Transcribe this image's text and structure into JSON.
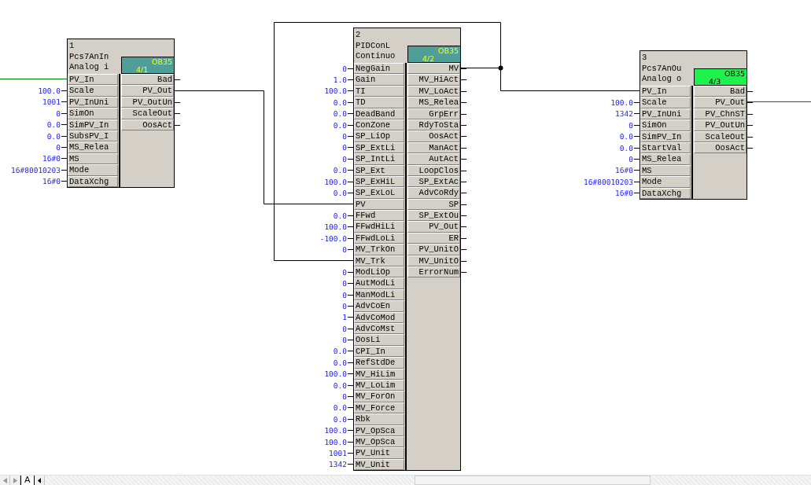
{
  "blocks": [
    {
      "number": "1",
      "type": "Pcs7AnIn",
      "comment": "Analog i",
      "task": {
        "name": "OB35",
        "sequence": "4/1",
        "color": "#4f9f98"
      },
      "inputs": [
        {
          "name": "PV_In"
        },
        {
          "name": "Scale",
          "value": "100.0"
        },
        {
          "name": "PV_InUni",
          "value": "1001"
        },
        {
          "name": "SimOn",
          "value": "0"
        },
        {
          "name": "SimPV_In",
          "value": "0.0"
        },
        {
          "name": "SubsPV_I",
          "value": "0.0"
        },
        {
          "name": "MS_Relea",
          "value": "0"
        },
        {
          "name": "MS",
          "value": "16#0"
        },
        {
          "name": "Mode",
          "value": "16#80010203"
        },
        {
          "name": "DataXchg",
          "value": "16#0"
        }
      ],
      "outputs": [
        {
          "name": "Bad"
        },
        {
          "name": "PV_Out"
        },
        {
          "name": "PV_OutUn"
        },
        {
          "name": "ScaleOut"
        },
        {
          "name": "OosAct"
        }
      ]
    },
    {
      "number": "2",
      "type": "PIDConL",
      "comment": "Continuo",
      "task": {
        "name": "OB35",
        "sequence": "4/2",
        "color": "#4f9f98"
      },
      "inputs": [
        {
          "name": "NegGain",
          "value": "0"
        },
        {
          "name": "Gain",
          "value": "1.0"
        },
        {
          "name": "TI",
          "value": "100.0"
        },
        {
          "name": "TD",
          "value": "0.0"
        },
        {
          "name": "DeadBand",
          "value": "0.0"
        },
        {
          "name": "ConZone",
          "value": "0.0"
        },
        {
          "name": "SP_LiOp",
          "value": "0"
        },
        {
          "name": "SP_ExtLi",
          "value": "0"
        },
        {
          "name": "SP_IntLi",
          "value": "0"
        },
        {
          "name": "SP_Ext",
          "value": "0.0"
        },
        {
          "name": "SP_ExHiL",
          "value": "100.0"
        },
        {
          "name": "SP_ExLoL",
          "value": "0.0"
        },
        {
          "name": "PV"
        },
        {
          "name": "FFwd",
          "value": "0.0"
        },
        {
          "name": "FFwdHiLi",
          "value": "100.0"
        },
        {
          "name": "FFwdLoLi",
          "value": "-100.0"
        },
        {
          "name": "MV_TrkOn",
          "value": "0"
        },
        {
          "name": "MV_Trk"
        },
        {
          "name": "ModLiOp",
          "value": "0"
        },
        {
          "name": "AutModLi",
          "value": "0"
        },
        {
          "name": "ManModLi",
          "value": "0"
        },
        {
          "name": "AdvCoEn",
          "value": "0"
        },
        {
          "name": "AdvCoMod",
          "value": "1"
        },
        {
          "name": "AdvCoMst",
          "value": "0"
        },
        {
          "name": "OosLi",
          "value": "0"
        },
        {
          "name": "CPI_In",
          "value": "0.0"
        },
        {
          "name": "RefStdDe",
          "value": "0.0"
        },
        {
          "name": "MV_HiLim",
          "value": "100.0"
        },
        {
          "name": "MV_LoLim",
          "value": "0.0"
        },
        {
          "name": "MV_ForOn",
          "value": "0"
        },
        {
          "name": "MV_Force",
          "value": "0.0"
        },
        {
          "name": "Rbk",
          "value": "0.0"
        },
        {
          "name": "PV_OpSca",
          "value": "100.0"
        },
        {
          "name": "MV_OpSca",
          "value": "100.0"
        },
        {
          "name": "PV_Unit",
          "value": "1001"
        },
        {
          "name": "MV_Unit",
          "value": "1342"
        }
      ],
      "outputs": [
        {
          "name": "MV"
        },
        {
          "name": "MV_HiAct"
        },
        {
          "name": "MV_LoAct"
        },
        {
          "name": "MS_Relea"
        },
        {
          "name": "GrpErr"
        },
        {
          "name": "RdyToSta"
        },
        {
          "name": "OosAct"
        },
        {
          "name": "ManAct"
        },
        {
          "name": "AutAct"
        },
        {
          "name": "LoopClos"
        },
        {
          "name": "SP_ExtAc"
        },
        {
          "name": "AdvCoRdy"
        },
        {
          "name": "SP"
        },
        {
          "name": "SP_ExtOu"
        },
        {
          "name": "PV_Out"
        },
        {
          "name": "ER"
        },
        {
          "name": "PV_UnitO"
        },
        {
          "name": "MV_UnitO"
        },
        {
          "name": "ErrorNum"
        }
      ]
    },
    {
      "number": "3",
      "type": "Pcs7AnOu",
      "comment": "Analog o",
      "task": {
        "name": "OB35",
        "sequence": "4/3",
        "color": "#1ef24c"
      },
      "inputs": [
        {
          "name": "PV_In"
        },
        {
          "name": "Scale",
          "value": "100.0"
        },
        {
          "name": "PV_InUni",
          "value": "1342"
        },
        {
          "name": "SimOn",
          "value": "0"
        },
        {
          "name": "SimPV_In",
          "value": "0.0"
        },
        {
          "name": "StartVal",
          "value": "0.0"
        },
        {
          "name": "MS_Relea",
          "value": "0"
        },
        {
          "name": "MS",
          "value": "16#0"
        },
        {
          "name": "Mode",
          "value": "16#80010203"
        },
        {
          "name": "DataXchg",
          "value": "16#0"
        }
      ],
      "outputs": [
        {
          "name": "Bad"
        },
        {
          "name": "PV_Out"
        },
        {
          "name": "PV_ChnST"
        },
        {
          "name": "PV_OutUn"
        },
        {
          "name": "ScaleOut"
        },
        {
          "name": "OosAct"
        }
      ]
    }
  ],
  "sheet_tab": "A"
}
